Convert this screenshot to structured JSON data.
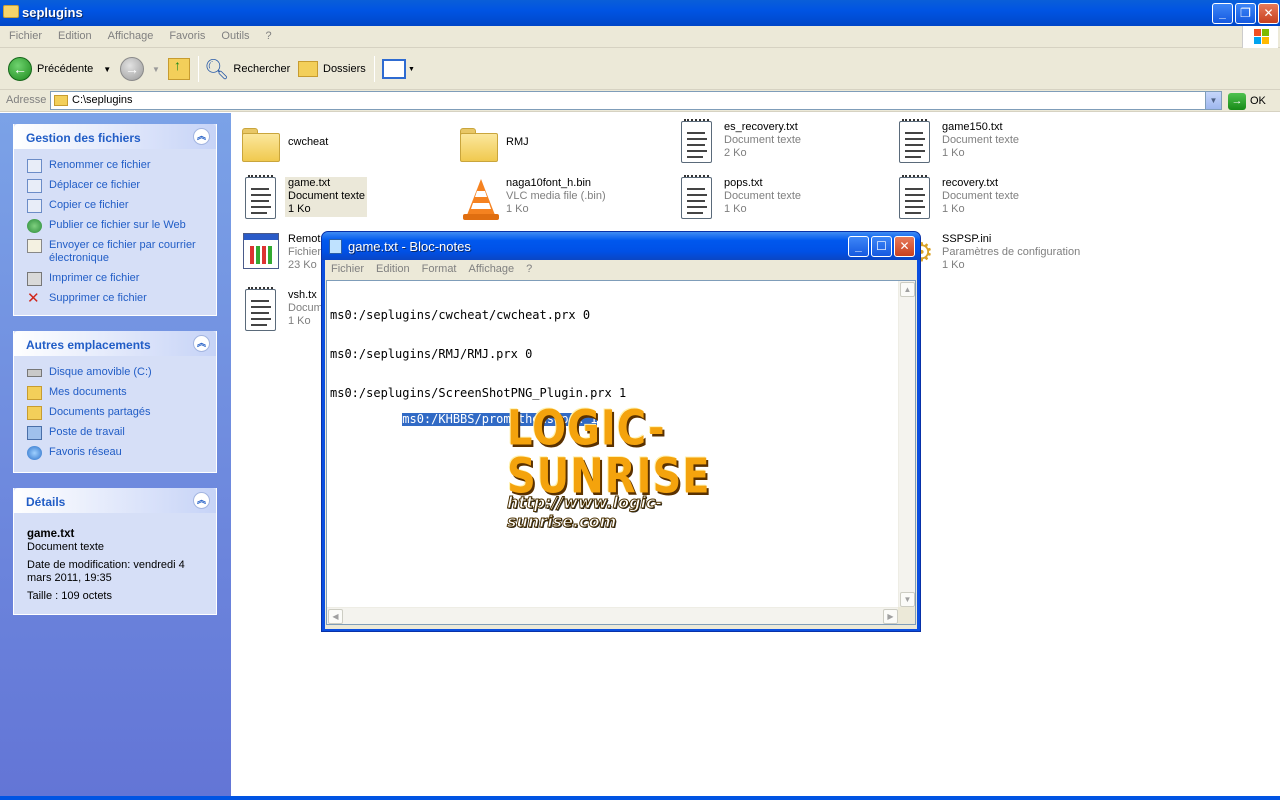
{
  "window": {
    "title": "seplugins"
  },
  "menu": [
    "Fichier",
    "Edition",
    "Affichage",
    "Favoris",
    "Outils",
    "?"
  ],
  "toolbar": {
    "back_label": "Précédente",
    "search_label": "Rechercher",
    "folders_label": "Dossiers"
  },
  "address": {
    "label": "Adresse",
    "value": "C:\\seplugins",
    "go_label": "OK"
  },
  "tasks": {
    "file_tasks_title": "Gestion des fichiers",
    "file_tasks": [
      {
        "label": "Renommer ce fichier",
        "icon": "rename-icon"
      },
      {
        "label": "Déplacer ce fichier",
        "icon": "move-icon"
      },
      {
        "label": "Copier ce fichier",
        "icon": "copy-icon"
      },
      {
        "label": "Publier ce fichier sur le Web",
        "icon": "web-publish-icon"
      },
      {
        "label": "Envoyer ce fichier par courrier électronique",
        "icon": "email-icon"
      },
      {
        "label": "Imprimer ce fichier",
        "icon": "printer-icon"
      },
      {
        "label": "Supprimer ce fichier",
        "icon": "delete-icon"
      }
    ],
    "other_places_title": "Autres emplacements",
    "other_places": [
      {
        "label": "Disque amovible (C:)",
        "icon": "removable-disk-icon"
      },
      {
        "label": "Mes documents",
        "icon": "my-documents-icon"
      },
      {
        "label": "Documents partagés",
        "icon": "shared-documents-icon"
      },
      {
        "label": "Poste de travail",
        "icon": "my-computer-icon"
      },
      {
        "label": "Favoris réseau",
        "icon": "network-icon"
      }
    ],
    "details_title": "Détails",
    "details": {
      "name": "game.txt",
      "type": "Document texte",
      "modified": "Date de modification: vendredi 4 mars 2011, 19:35",
      "size": "Taille : 109 octets"
    }
  },
  "files": [
    {
      "name": "cwcheat",
      "type": "",
      "size": "",
      "icon": "folder-icon"
    },
    {
      "name": "RMJ",
      "type": "",
      "size": "",
      "icon": "folder-icon"
    },
    {
      "name": "es_recovery.txt",
      "type": "Document texte",
      "size": "2 Ko",
      "icon": "text-document-icon"
    },
    {
      "name": "game150.txt",
      "type": "Document texte",
      "size": "1 Ko",
      "icon": "text-document-icon"
    },
    {
      "name": "game.txt",
      "type": "Document texte",
      "size": "1 Ko",
      "icon": "text-document-icon"
    },
    {
      "name": "naga10font_h.bin",
      "type": "VLC media file (.bin)",
      "size": "1 Ko",
      "icon": "vlc-icon"
    },
    {
      "name": "pops.txt",
      "type": "Document texte",
      "size": "1 Ko",
      "icon": "text-document-icon"
    },
    {
      "name": "recovery.txt",
      "type": "Document texte",
      "size": "1 Ko",
      "icon": "text-document-icon"
    },
    {
      "name": "Remot",
      "type": "Fichier",
      "size": "23 Ko",
      "icon": "application-icon"
    },
    {
      "name": "SSPSP.ini",
      "type": "Paramètres de configuration",
      "size": "1 Ko",
      "icon": "settings-file-icon"
    },
    {
      "name": "vsh.tx",
      "type": "Docum",
      "size": "1 Ko",
      "icon": "text-document-icon"
    }
  ],
  "notepad": {
    "title": "game.txt - Bloc-notes",
    "menu": [
      "Fichier",
      "Edition",
      "Format",
      "Affichage",
      "?"
    ],
    "lines": [
      "ms0:/seplugins/cwcheat/cwcheat.prx 0",
      "ms0:/seplugins/RMJ/RMJ.prx 0",
      "ms0:/seplugins/ScreenShotPNG_Plugin.prx 1",
      "ms0:/KHBBS/prometheus.prx 1"
    ]
  },
  "watermark": {
    "title": "LOGIC-SUNRISE",
    "url": "http://www.logic-sunrise.com"
  }
}
